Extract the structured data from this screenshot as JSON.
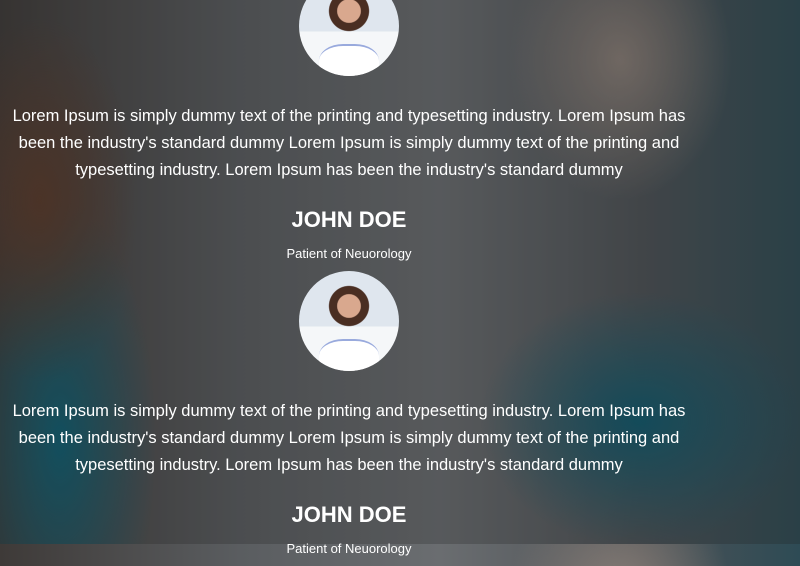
{
  "testimonials": [
    {
      "text": "Lorem Ipsum is simply dummy text of the printing and typesetting industry. Lorem Ipsum has been the industry's standard dummy Lorem Ipsum is simply dummy text of the printing and typesetting industry. Lorem Ipsum has been the industry's standard dummy",
      "name": "JOHN DOE",
      "role": "Patient of Neuorology"
    },
    {
      "text": "Lorem Ipsum is simply dummy text of the printing and typesetting industry. Lorem Ipsum has been the industry's standard dummy Lorem Ipsum is simply dummy text of the printing and typesetting industry. Lorem Ipsum has been the industry's standard dummy",
      "name": "JOHN DOE",
      "role": "Patient of Neuorology"
    }
  ]
}
